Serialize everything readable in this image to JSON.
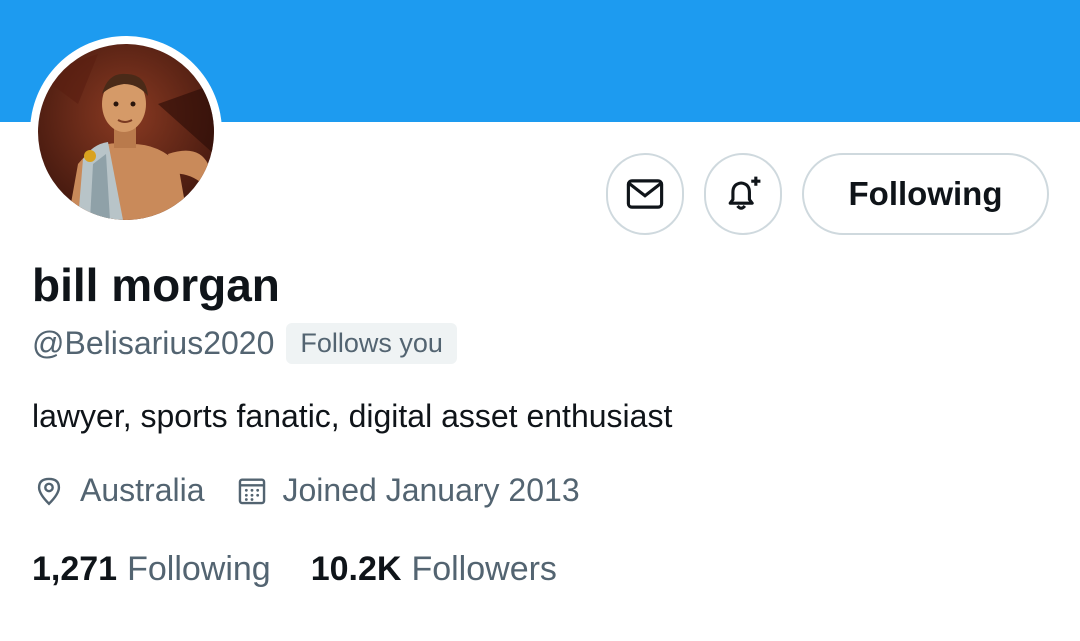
{
  "profile": {
    "name": "bill morgan",
    "handle": "@Belisarius2020",
    "follows_you": "Follows you",
    "bio": "lawyer, sports fanatic, digital asset enthusiast",
    "location": "Australia",
    "joined": "Joined January 2013"
  },
  "actions": {
    "message_icon": "envelope-icon",
    "notify_icon": "bell-plus-icon",
    "follow_label": "Following"
  },
  "stats": {
    "following_count": "1,271",
    "following_label": "Following",
    "followers_count": "10.2K",
    "followers_label": "Followers"
  },
  "colors": {
    "banner": "#1d9bf0",
    "primary_text": "#0f1419",
    "secondary_text": "#536471",
    "border": "#cfd9de",
    "badge_bg": "#eff3f4"
  }
}
